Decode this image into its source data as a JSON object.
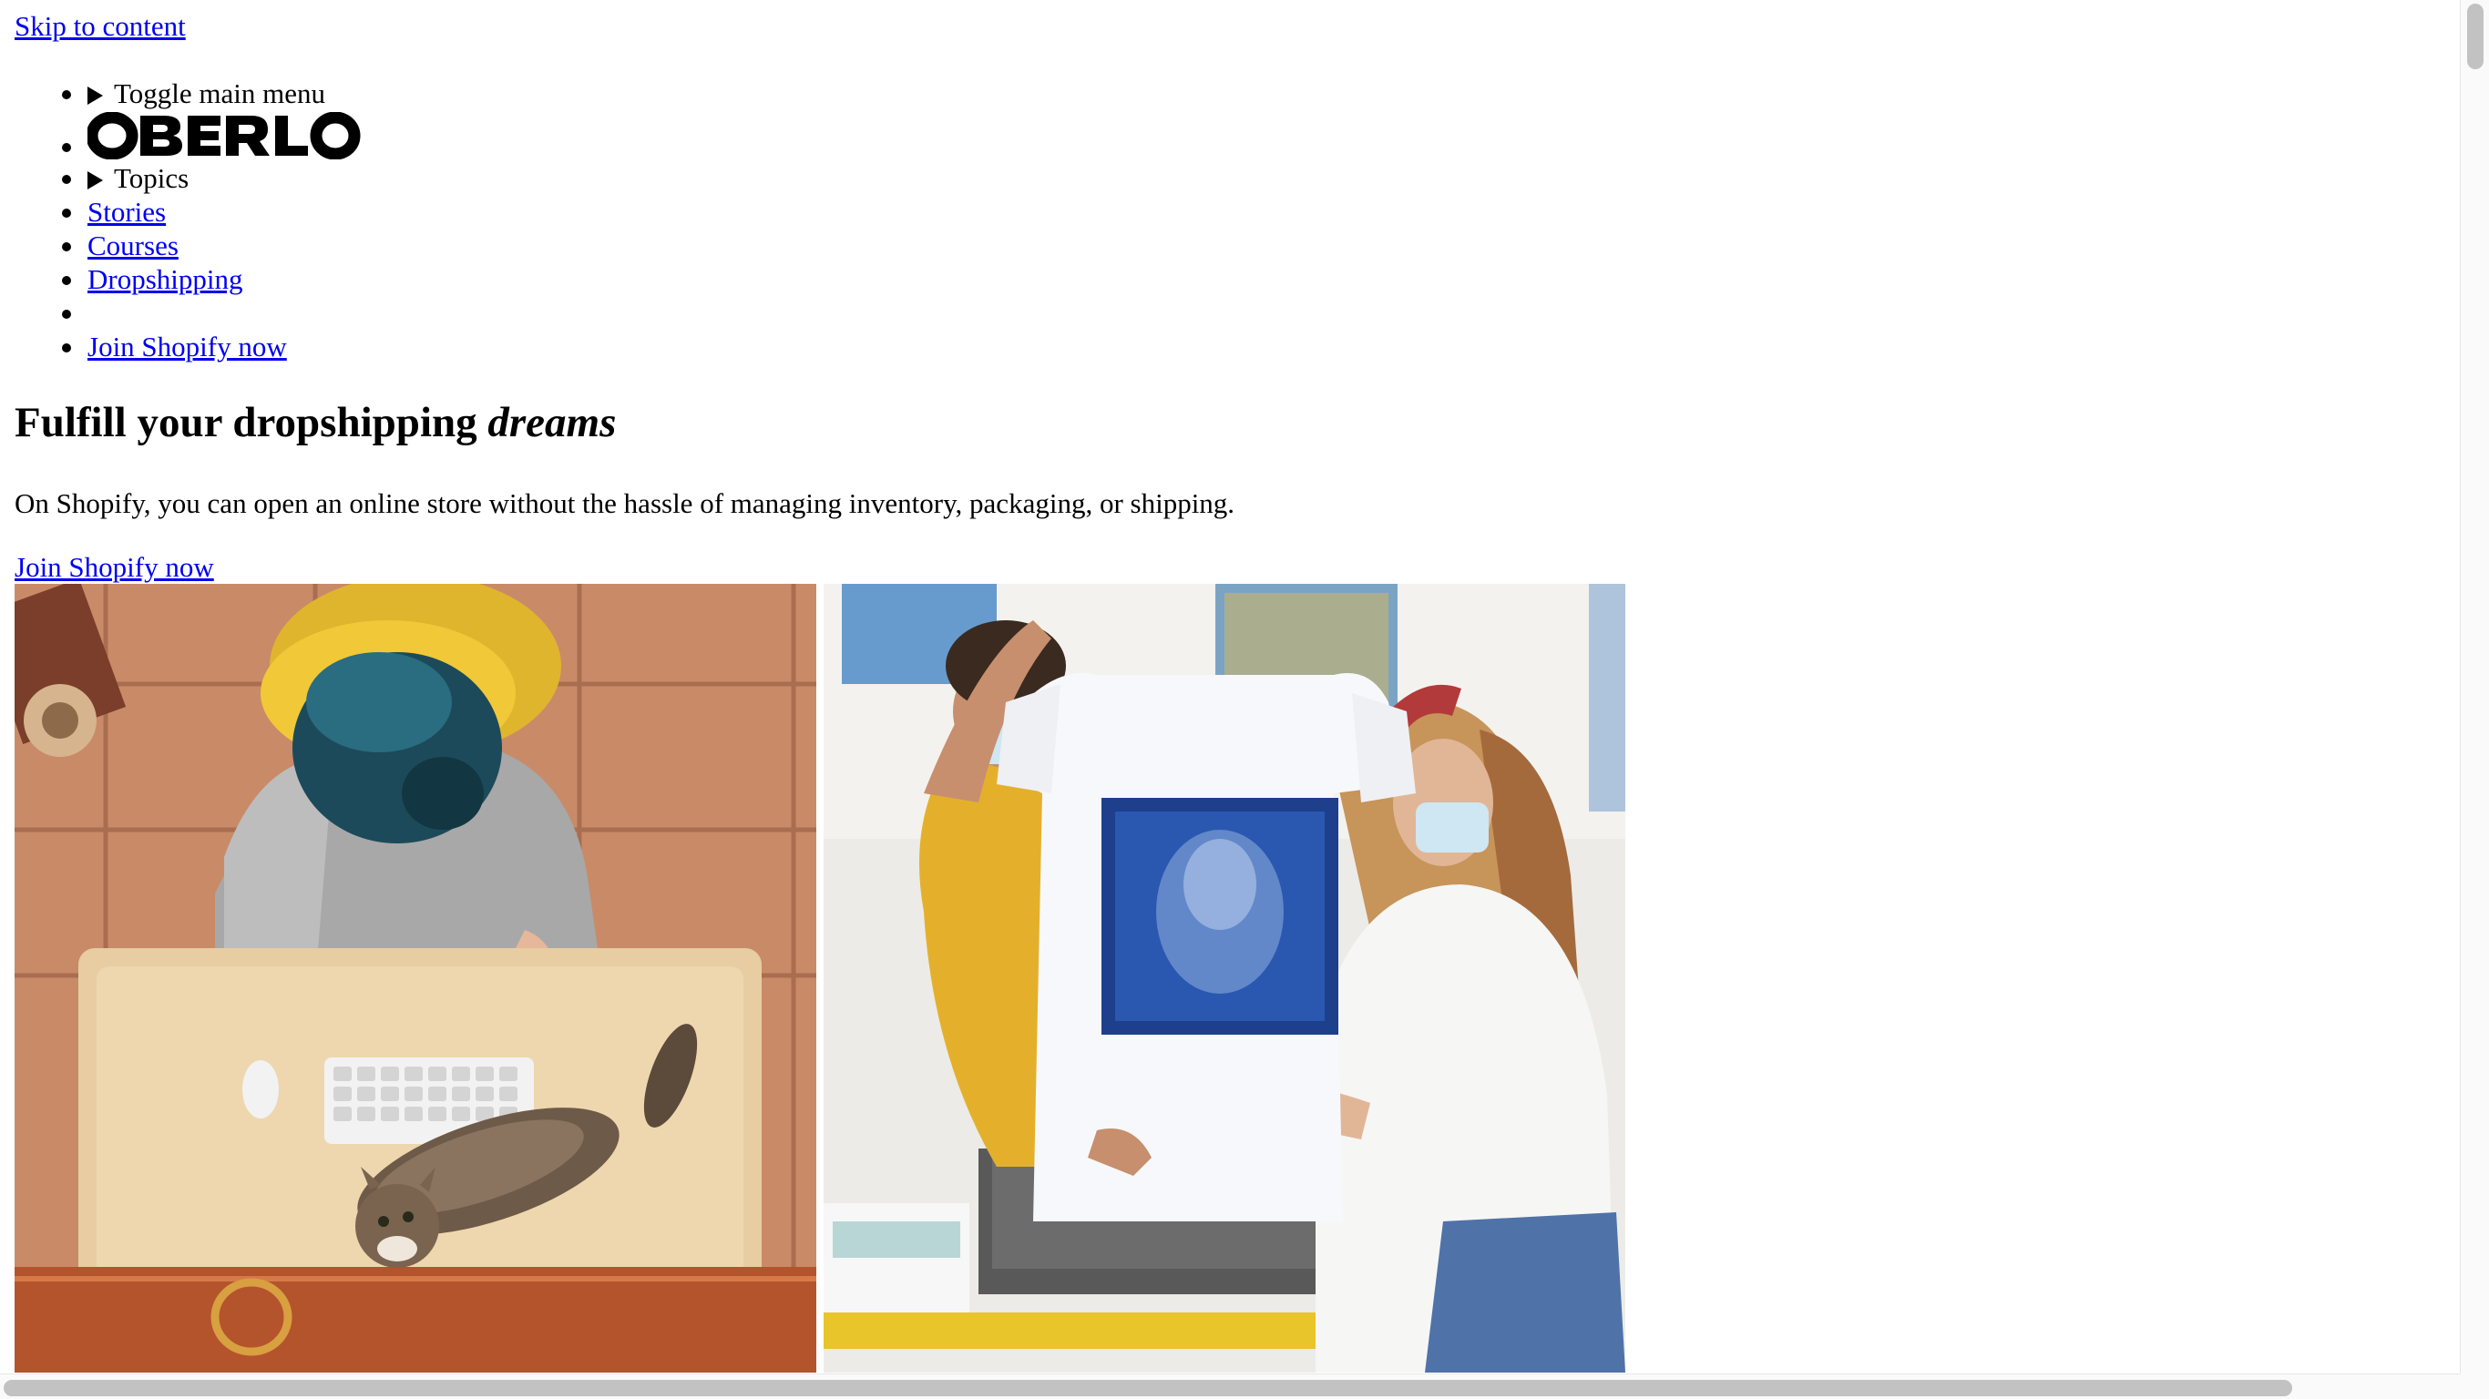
{
  "skip_link": "Skip to content",
  "nav": {
    "toggle_menu": "Toggle main menu",
    "logo_text": "OBERLO",
    "topics": "Topics",
    "stories": "Stories",
    "courses": "Courses",
    "dropshipping": "Dropshipping",
    "join": "Join Shopify now"
  },
  "hero": {
    "title_plain": "Fulfill your dropshipping",
    "title_emphasis": "dreams",
    "text": "On Shopify, you can open an online store without the hassle of managing inventory, packaging, or shipping.",
    "cta": "Join Shopify now"
  },
  "colors": {
    "link": "#0000ee",
    "text": "#000000",
    "scrollbar_thumb": "#c2c2c2"
  }
}
